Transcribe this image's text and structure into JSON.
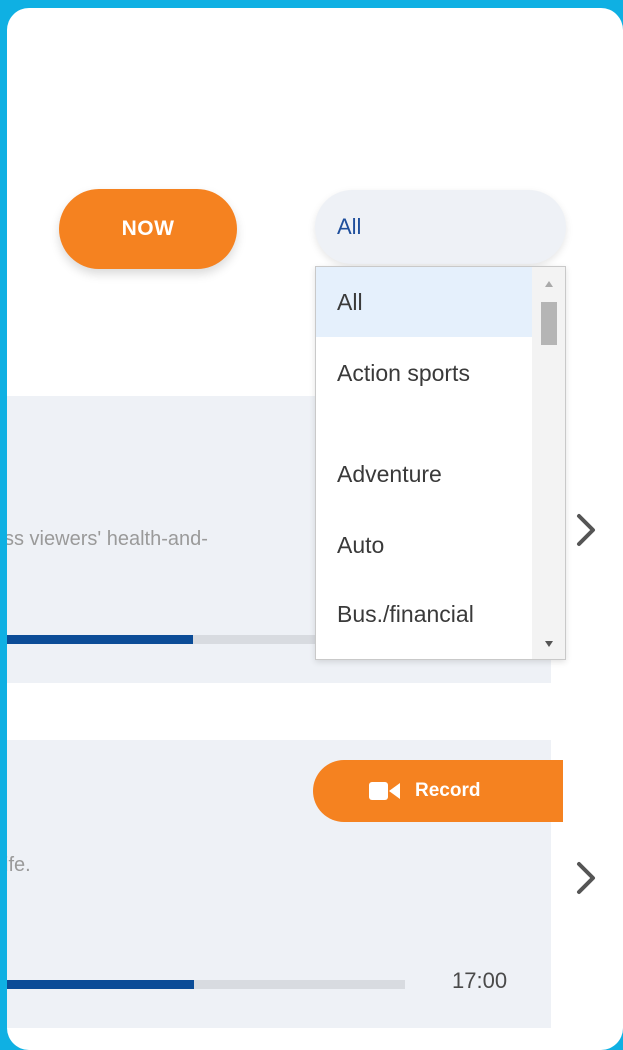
{
  "filters": {
    "now_label": "NOW",
    "category_select": {
      "selected": "All",
      "options": [
        "All",
        "Action sports",
        "Adventure",
        "Auto",
        "Bus./financial"
      ]
    }
  },
  "programs": [
    {
      "description": "ss viewers' health-and-",
      "progress_percent": 46
    },
    {
      "description": "ife.",
      "record_label": "Record",
      "progress_percent": 48,
      "time": "17:00"
    }
  ],
  "colors": {
    "background": "#0fb0e3",
    "accent_orange": "#f58220",
    "progress_blue": "#0b4c97",
    "card_bg": "#eef1f6"
  },
  "icons": [
    "video-camera-icon",
    "chevron-right-icon",
    "scroll-up-arrow-icon",
    "scroll-down-arrow-icon"
  ]
}
